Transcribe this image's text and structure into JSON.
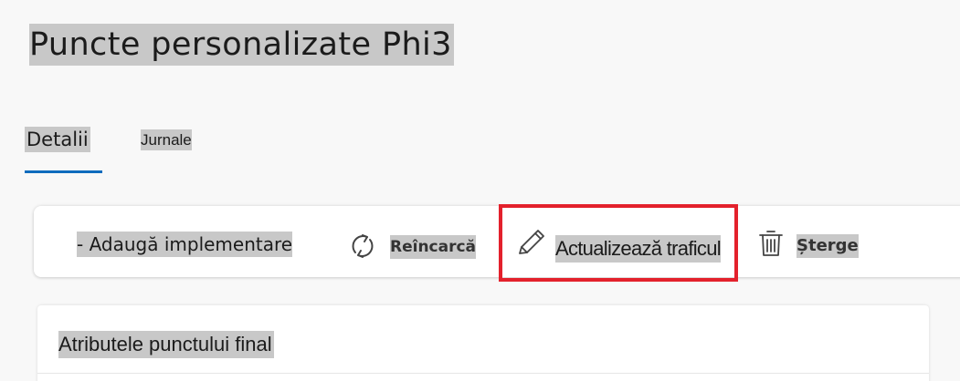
{
  "page": {
    "title": "Puncte personalizate Phi3"
  },
  "tabs": [
    {
      "label": "Detalii",
      "selected": true
    },
    {
      "label": "Jurnale",
      "selected": false
    }
  ],
  "toolbar": {
    "add_label": "- Adaugă implementare",
    "refresh": {
      "label": "Reîncarcă",
      "icon": "refresh-icon"
    },
    "update_traffic": {
      "label": "Actualizează traficul",
      "icon": "pencil-icon",
      "highlighted": true
    },
    "delete": {
      "label": "Șterge",
      "icon": "trash-icon"
    }
  },
  "panel": {
    "title": "Atributele punctului final"
  },
  "colors": {
    "accent": "#0f6cbd",
    "highlight_box": "#e3212c",
    "text_highlight": "#c8c8c8",
    "background": "#f8f8f8"
  }
}
